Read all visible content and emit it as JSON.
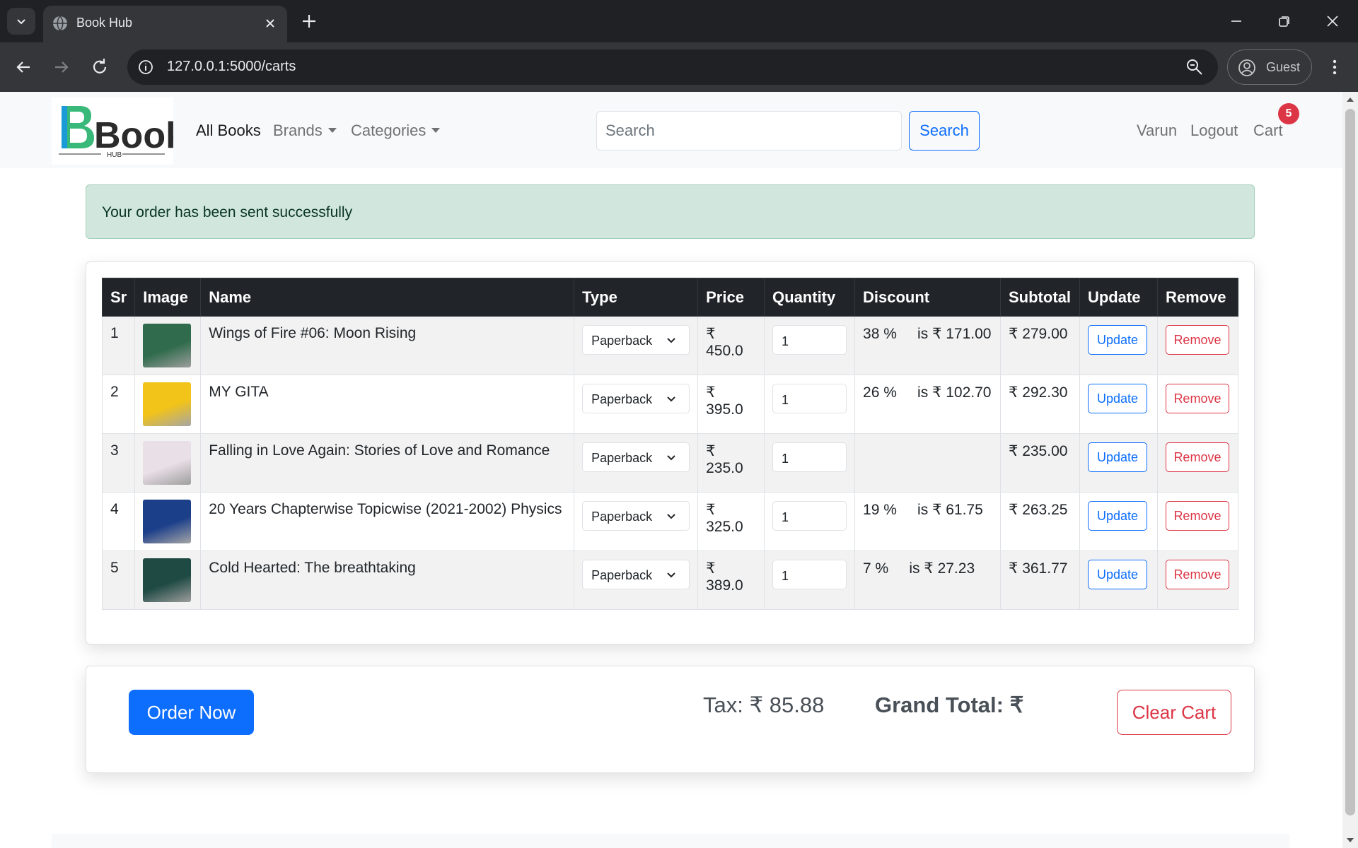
{
  "browser": {
    "tab_title": "Book Hub",
    "url": "127.0.0.1:5000/carts",
    "profile_name": "Guest"
  },
  "navbar": {
    "logo_text": "Book",
    "logo_sub": "HUB",
    "links": {
      "all_books": "All Books",
      "brands": "Brands",
      "categories": "Categories"
    },
    "search_placeholder": "Search",
    "search_button": "Search",
    "user": "Varun",
    "logout": "Logout",
    "cart": "Cart",
    "cart_count": "5"
  },
  "alert": {
    "message": "Your order has been sent successfully"
  },
  "table": {
    "headers": [
      "Sr",
      "Image",
      "Name",
      "Type",
      "Price",
      "Quantity",
      "Discount",
      "Subtotal",
      "Update",
      "Remove"
    ],
    "rows": [
      {
        "sr": "1",
        "name": "Wings of Fire #06: Moon Rising",
        "type": "Paperback",
        "price": "₹ 450.0",
        "quantity": "1",
        "discount": "38 %     is ₹ 171.00",
        "subtotal": "₹ 279.00",
        "update": "Update",
        "remove": "Remove",
        "cover_color": "#2f6b4c"
      },
      {
        "sr": "2",
        "name": "MY GITA",
        "type": "Paperback",
        "price": "₹ 395.0",
        "quantity": "1",
        "discount": "26 %     is ₹ 102.70",
        "subtotal": "₹ 292.30",
        "update": "Update",
        "remove": "Remove",
        "cover_color": "#f2c318"
      },
      {
        "sr": "3",
        "name": "Falling in Love Again: Stories of Love and Romance",
        "type": "Paperback",
        "price": "₹ 235.0",
        "quantity": "1",
        "discount": "",
        "subtotal": "₹ 235.00",
        "update": "Update",
        "remove": "Remove",
        "cover_color": "#e9dfe6"
      },
      {
        "sr": "4",
        "name": "20 Years Chapterwise Topicwise (2021-2002) Physics",
        "type": "Paperback",
        "price": "₹ 325.0",
        "quantity": "1",
        "discount": "19 %     is ₹ 61.75",
        "subtotal": "₹ 263.25",
        "update": "Update",
        "remove": "Remove",
        "cover_color": "#1c3f8a"
      },
      {
        "sr": "5",
        "name": "Cold Hearted: The breathtaking",
        "type": "Paperback",
        "price": "₹ 389.0",
        "quantity": "1",
        "discount": "7 %     is ₹ 27.23",
        "subtotal": "₹ 361.77",
        "update": "Update",
        "remove": "Remove",
        "cover_color": "#1f4a44"
      }
    ]
  },
  "summary": {
    "order_button": "Order Now",
    "tax": "Tax: ₹ 85.88",
    "grand_total": "Grand Total: ₹",
    "clear_button": "Clear Cart"
  },
  "colors": {
    "primary": "#0d6efd",
    "danger": "#dc3545",
    "success_bg": "#d1e7dd",
    "table_head": "#212529"
  }
}
